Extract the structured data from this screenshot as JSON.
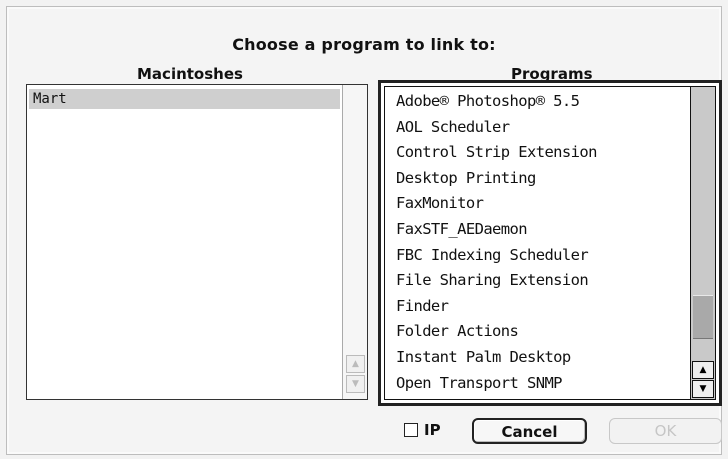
{
  "dialog": {
    "title": "Choose a program to link to:"
  },
  "macintoshes": {
    "header": "Macintoshes",
    "items": [
      "Mart"
    ],
    "selected": "Mart"
  },
  "programs": {
    "header": "Programs",
    "items": [
      "Adobe® Photoshop® 5.5",
      "AOL Scheduler",
      "Control Strip Extension",
      "Desktop Printing",
      "FaxMonitor",
      "FaxSTF_AEDaemon",
      "FBC Indexing Scheduler",
      "File Sharing Extension",
      "Finder",
      "Folder Actions",
      "Instant Palm Desktop",
      "Open Transport SNMP"
    ]
  },
  "ip_checkbox": {
    "label": "IP",
    "checked": false
  },
  "buttons": {
    "cancel": "Cancel",
    "ok": "OK"
  },
  "icons": {
    "scroll_up": "scroll-up-arrow-icon",
    "scroll_down": "scroll-down-arrow-icon"
  }
}
